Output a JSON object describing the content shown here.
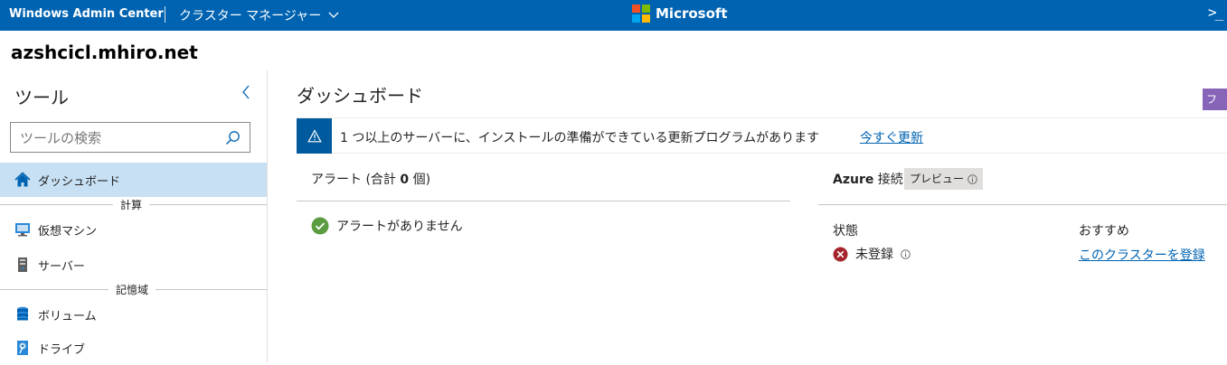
{
  "topbar": {
    "app_name": "Windows Admin Center",
    "manager_label": "クラスター マネージャー",
    "brand": "Microsoft",
    "terminal_glyph": ">_",
    "colors": {
      "bar": "#0063b1",
      "ms_red": "#f25022",
      "ms_green": "#7fba00",
      "ms_blue": "#00a4ef",
      "ms_yellow": "#ffb900"
    }
  },
  "host": {
    "name": "azshcicl.mhiro.net"
  },
  "sidebar": {
    "title": "ツール",
    "search_placeholder": "ツールの検索",
    "items": [
      {
        "label": "ダッシュボード",
        "icon": "home-icon",
        "active": true
      },
      {
        "label": "仮想マシン",
        "icon": "virtual-machine-icon"
      },
      {
        "label": "サーバー",
        "icon": "server-icon"
      },
      {
        "label": "ボリューム",
        "icon": "volume-icon"
      },
      {
        "label": "ドライブ",
        "icon": "drive-icon"
      }
    ],
    "groups": {
      "compute": "計算",
      "storage": "記憶域"
    }
  },
  "main": {
    "title": "ダッシュボード",
    "right_tag": "フィ",
    "banner": {
      "text": "1 つ以上のサーバーに、インストールの準備ができている更新プログラムがあります",
      "link": "今すぐ更新"
    },
    "alerts": {
      "title_prefix": "アラート (合計 ",
      "count": "0",
      "title_suffix": " 個)",
      "empty_text": "アラートがありません"
    },
    "azure": {
      "title_bold": "Azure",
      "title_rest": " 接続",
      "preview_label": "プレビュー",
      "status_heading": "状態",
      "status_value": "未登録",
      "recommend_heading": "おすすめ",
      "recommend_link": "このクラスターを登録"
    }
  }
}
